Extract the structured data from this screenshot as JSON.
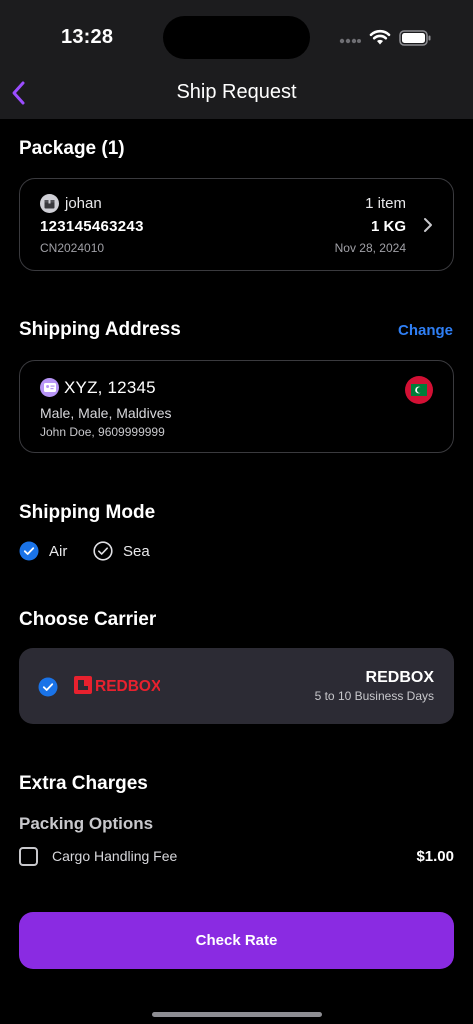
{
  "status_bar": {
    "time": "13:28"
  },
  "header": {
    "title": "Ship Request"
  },
  "package_section": {
    "title": "Package (1)",
    "package": {
      "name": "johan",
      "items": "1 item",
      "tracking": "123145463243",
      "weight": "1 KG",
      "code": "CN2024010",
      "date": "Nov 28, 2024"
    }
  },
  "address_section": {
    "title": "Shipping Address",
    "change_label": "Change",
    "address": {
      "title": "XYZ, 12345",
      "line": "Male, Male, Maldives",
      "contact": "John Doe, 9609999999",
      "flag": "maldives-flag"
    }
  },
  "mode_section": {
    "title": "Shipping Mode",
    "options": [
      {
        "label": "Air",
        "selected": true
      },
      {
        "label": "Sea",
        "selected": false
      }
    ]
  },
  "carrier_section": {
    "title": "Choose Carrier",
    "carrier": {
      "logo_text": "REDBOX",
      "name": "REDBOX",
      "days": "5 to 10 Business Days",
      "selected": true
    }
  },
  "extra_section": {
    "title": "Extra Charges",
    "packing_title": "Packing Options",
    "fee": {
      "label": "Cargo Handling Fee",
      "amount": "$1.00",
      "checked": false
    }
  },
  "action": {
    "check_rate_label": "Check Rate"
  },
  "colors": {
    "accent": "#8a2be2",
    "link": "#2f7ff5",
    "check": "#1a73e8",
    "redbox": "#e8212e"
  }
}
